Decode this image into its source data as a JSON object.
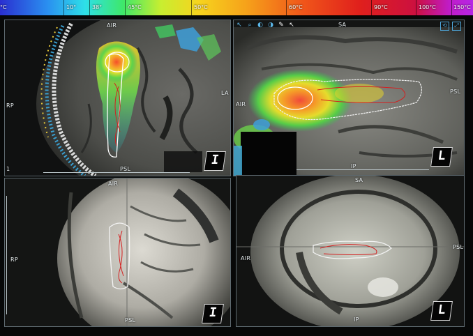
{
  "temperature_scale": {
    "labels": [
      {
        "text": "°C",
        "pos": 0.0
      },
      {
        "text": "10°",
        "pos": 0.14
      },
      {
        "text": "38°",
        "pos": 0.195
      },
      {
        "text": "45°C",
        "pos": 0.27
      },
      {
        "text": "50°C",
        "pos": 0.41
      },
      {
        "text": "60°C",
        "pos": 0.61
      },
      {
        "text": "90°C",
        "pos": 0.79
      },
      {
        "text": "100°C",
        "pos": 0.885
      },
      {
        "text": "150°C",
        "pos": 0.96
      }
    ],
    "colors": [
      "#2a2fd0",
      "#2ee0e8",
      "#3ee86a",
      "#f6d41e",
      "#f0561a",
      "#e0201c",
      "#b626e6"
    ]
  },
  "views": {
    "axial": {
      "top": "AIR",
      "left": "RP",
      "right": "LA",
      "bottom": "PSL",
      "index": "1",
      "cube_label": "I"
    },
    "sagittal": {
      "top": "SA",
      "left": "AIR",
      "right": "PSL",
      "bottom": "IP",
      "cube_label": "L"
    },
    "axial_magnitude": {
      "top": "AIR",
      "left": "RP",
      "bottom": "PSL",
      "cube_label": "I"
    },
    "sagittal_magnitude": {
      "top": "SA",
      "left": "AIR",
      "right": "PSL",
      "bottom": "IP",
      "cube_label": "L"
    }
  },
  "toolbar": {
    "tools": [
      "pointer-icon",
      "zoom-icon",
      "contrast-icon",
      "window-level-icon",
      "pan-icon",
      "cursor-icon"
    ],
    "tool_glyphs": [
      "↖",
      "⌕",
      "◐",
      "◑",
      "✎",
      "↖"
    ],
    "window_controls": [
      "⟲",
      "⤢"
    ]
  }
}
